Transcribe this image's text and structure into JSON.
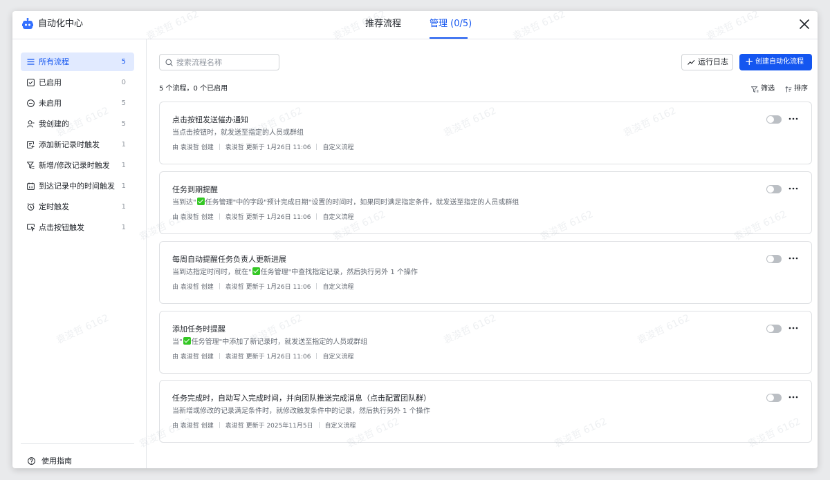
{
  "header": {
    "app_title": "自动化中心",
    "tabs": [
      {
        "label": "推荐流程"
      },
      {
        "label": "管理 (0/5)"
      }
    ]
  },
  "sidebar": {
    "items": [
      {
        "label": "所有流程",
        "count": "5",
        "icon": "list-icon"
      },
      {
        "label": "已启用",
        "count": "0",
        "icon": "check-square-icon"
      },
      {
        "label": "未启用",
        "count": "5",
        "icon": "minus-circle-icon"
      },
      {
        "label": "我创建的",
        "count": "5",
        "icon": "user-icon"
      },
      {
        "label": "添加新记录时触发",
        "count": "1",
        "icon": "add-record-icon"
      },
      {
        "label": "新增/修改记录时触发",
        "count": "1",
        "icon": "filter-edit-icon"
      },
      {
        "label": "到达记录中的时间触发",
        "count": "1",
        "icon": "calendar-icon"
      },
      {
        "label": "定时触发",
        "count": "1",
        "icon": "alarm-clock-icon"
      },
      {
        "label": "点击按钮触发",
        "count": "1",
        "icon": "button-click-icon"
      }
    ],
    "guide_label": "使用指南"
  },
  "toolbar": {
    "search_placeholder": "搜索流程名称",
    "log_label": "运行日志",
    "create_label": "创建自动化流程",
    "summary": "5 个流程，0 个已启用",
    "filter_label": "筛选",
    "sort_label": "排序"
  },
  "flows": [
    {
      "title": "点击按钮发送催办通知",
      "desc_before": "当点击按钮时，就发送至指定的人员或群组",
      "desc_after": "",
      "has_table": false,
      "creator": "由 袁浚哲 创建",
      "updated": "袁浚哲 更新于 1月26日 11:06",
      "type": "自定义流程",
      "enabled": false
    },
    {
      "title": "任务到期提醒",
      "desc_before": "当到达\"",
      "desc_after": "任务管理\"中的字段\"预计完成日期\"设置的时间时，如果同时满足指定条件，就发送至指定的人员或群组",
      "has_table": true,
      "creator": "由 袁浚哲 创建",
      "updated": "袁浚哲 更新于 1月26日 11:06",
      "type": "自定义流程",
      "enabled": false
    },
    {
      "title": "每周自动提醒任务负责人更新进展",
      "desc_before": "当到达指定时间时，就在\"",
      "desc_after": "任务管理\"中查找指定记录，然后执行另外 1 个操作",
      "has_table": true,
      "creator": "由 袁浚哲 创建",
      "updated": "袁浚哲 更新于 1月26日 11:06",
      "type": "自定义流程",
      "enabled": false
    },
    {
      "title": "添加任务时提醒",
      "desc_before": "当\"",
      "desc_after": "任务管理\"中添加了新记录时，就发送至指定的人员或群组",
      "has_table": true,
      "creator": "由 袁浚哲 创建",
      "updated": "袁浚哲 更新于 1月26日 11:06",
      "type": "自定义流程",
      "enabled": false
    },
    {
      "title": "任务完成时，自动写入完成时间，并向团队推送完成消息（点击配置团队群）",
      "desc_before": "当新增或修改的记录满足条件时，就修改触发条件中的记录，然后执行另外 1 个操作",
      "desc_after": "",
      "has_table": false,
      "creator": "由 袁浚哲 创建",
      "updated": "袁浚哲 更新于 2025年11月5日",
      "type": "自定义流程",
      "enabled": false
    }
  ],
  "watermark": "袁浚哲 6162",
  "colors": {
    "accent": "#1456f0",
    "active_bg": "#e1eaff",
    "table_icon": "#34c724",
    "toggle_off": "#bbbfc4"
  }
}
